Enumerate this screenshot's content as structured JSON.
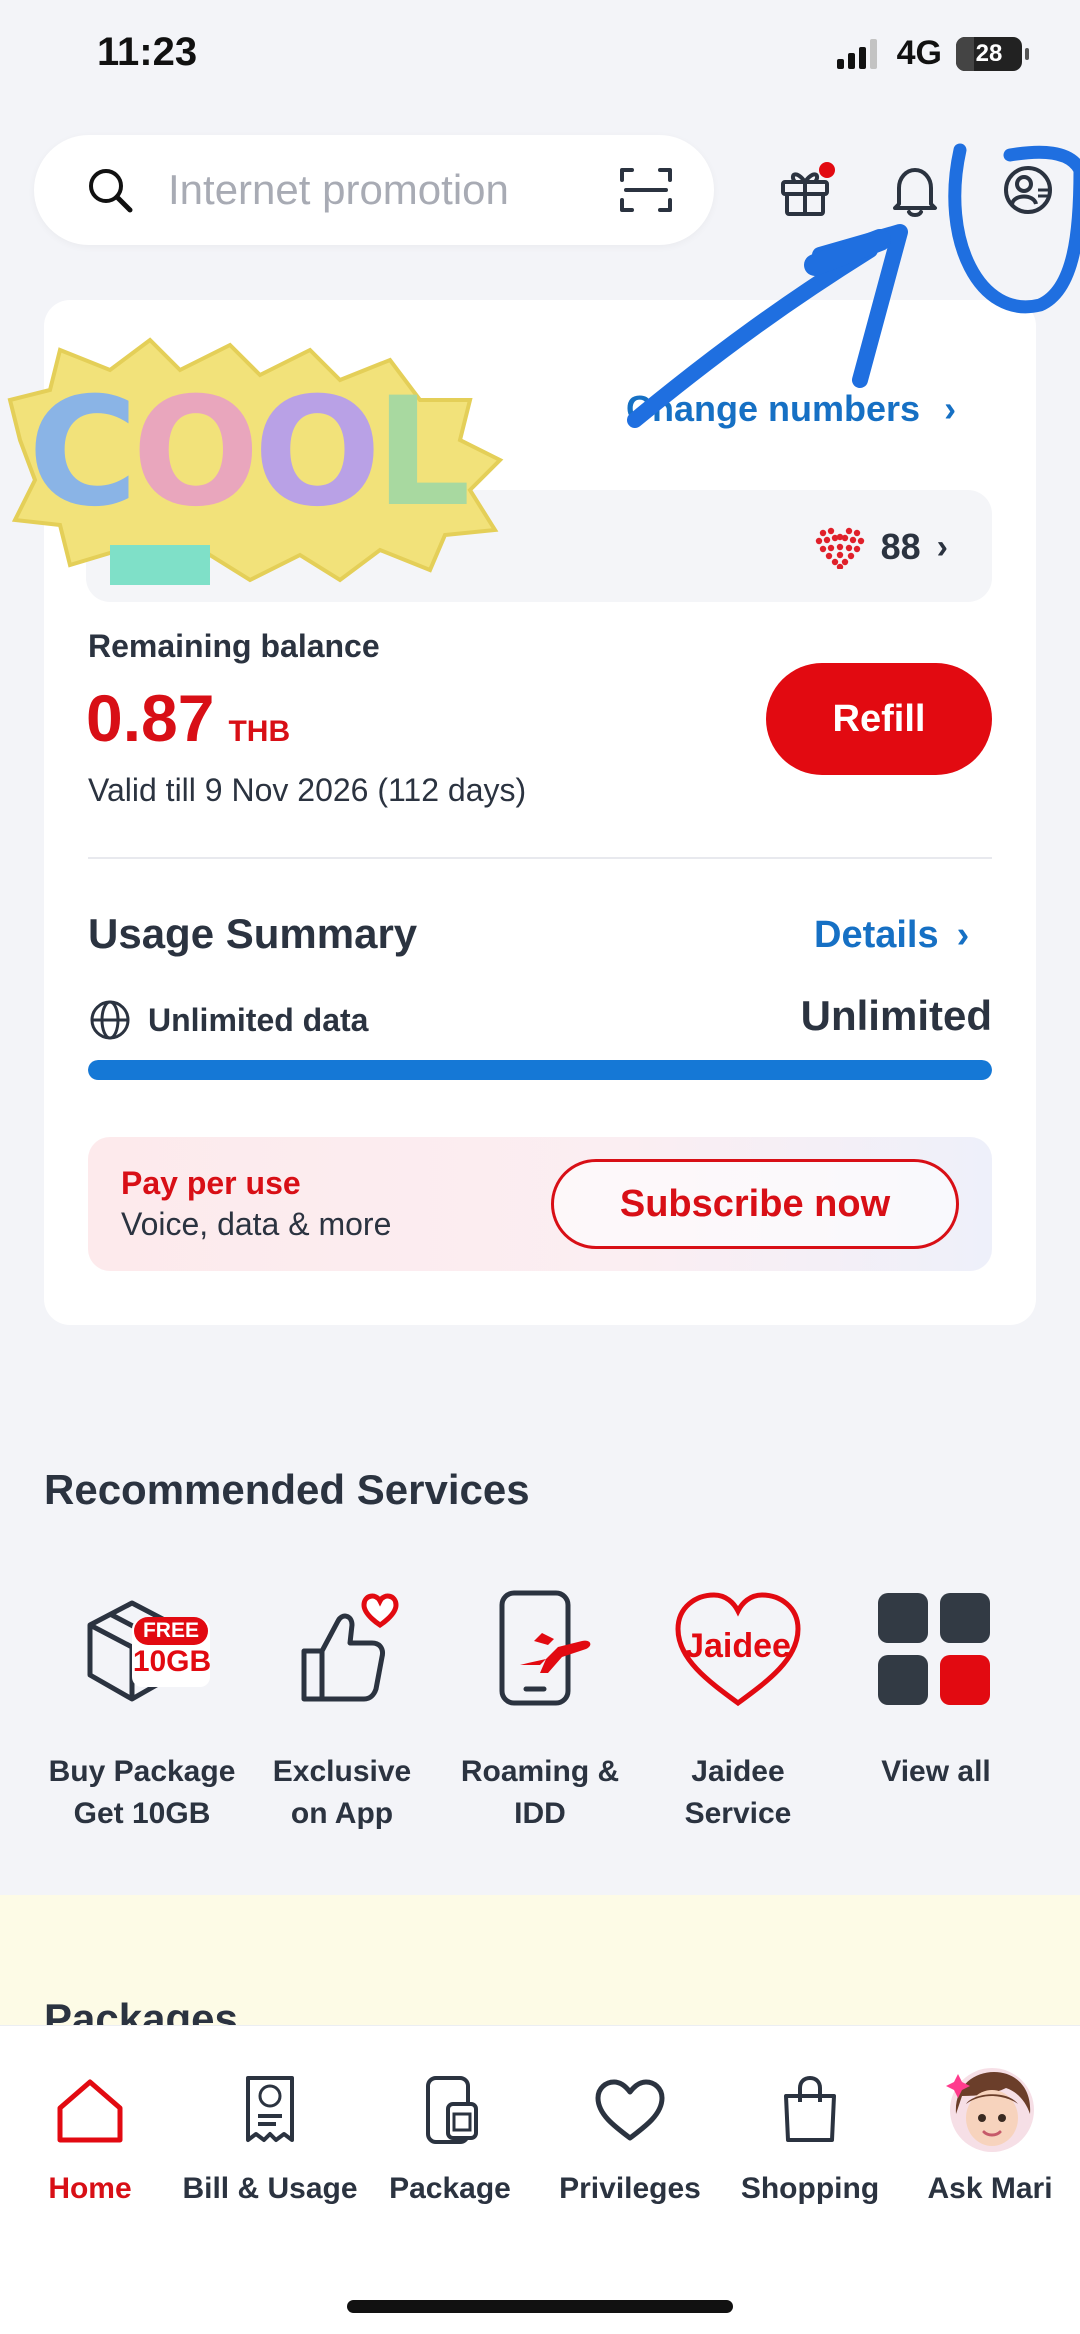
{
  "status_bar": {
    "time": "11:23",
    "network": "4G",
    "battery": "28",
    "battery_level": 0.28
  },
  "search": {
    "placeholder": "Internet promotion"
  },
  "account": {
    "change_numbers_label": "Change numbers",
    "points": "88"
  },
  "balance": {
    "label": "Remaining balance",
    "amount": "0.87",
    "currency": "THB",
    "validity": "Valid till 9 Nov 2026 (112 days)",
    "refill_label": "Refill"
  },
  "usage": {
    "title": "Usage Summary",
    "details_label": "Details",
    "data_label": "Unlimited data",
    "data_value": "Unlimited",
    "data_fill_fraction": 1.0
  },
  "pay_per_use": {
    "title": "Pay per use",
    "subtitle": "Voice, data & more",
    "subscribe_label": "Subscribe now"
  },
  "recommended": {
    "title": "Recommended Services",
    "items": [
      {
        "line1": "Buy Package",
        "line2": "Get 10GB",
        "icon": "package-box-icon",
        "badge_top": "FREE",
        "badge_bottom": "10GB"
      },
      {
        "line1": "Exclusive",
        "line2": "on App",
        "icon": "thumbs-up-heart-icon"
      },
      {
        "line1": "Roaming &",
        "line2": "IDD",
        "icon": "phone-airplane-icon"
      },
      {
        "line1": "Jaidee",
        "line2": "Service",
        "icon": "jaidee-heart-icon",
        "icon_text": "Jaidee"
      },
      {
        "line1": "View all",
        "line2": "",
        "icon": "grid-icon"
      }
    ]
  },
  "packages": {
    "title": "Packages"
  },
  "nav": {
    "items": [
      {
        "label": "Home",
        "icon": "home-icon"
      },
      {
        "label": "Bill & Usage",
        "icon": "bill-icon"
      },
      {
        "label": "Package",
        "icon": "package-icon"
      },
      {
        "label": "Privileges",
        "icon": "heart-icon"
      },
      {
        "label": "Shopping",
        "icon": "shopping-bag-icon"
      },
      {
        "label": "Ask Mari",
        "icon": "mari-avatar-icon"
      }
    ]
  },
  "sticker": {
    "text": "COOL"
  },
  "colors": {
    "brand_red": "#e20a11",
    "link_blue": "#1670c4",
    "bar_blue": "#1578d6",
    "annotation_blue": "#1f6fe0"
  }
}
